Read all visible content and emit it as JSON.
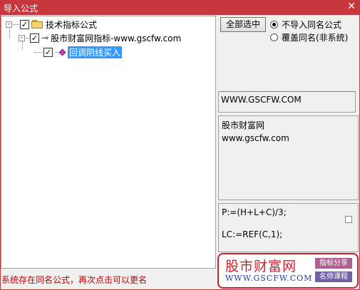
{
  "window": {
    "title": "导入公式",
    "close": "✕"
  },
  "tree": {
    "root": {
      "label": "技术指标公式",
      "expander": "-"
    },
    "child": {
      "label": "股市财富网指标-www.gscfw.com",
      "expander": "-"
    },
    "leaf": {
      "label": "回调阴线买入"
    }
  },
  "controls": {
    "select_all": "全部选中",
    "radio_skip": "不导入同名公式",
    "radio_overwrite": "覆盖同名(非系统)"
  },
  "url_box": "WWW.GSCFW.COM",
  "info": {
    "line1": "股市财富网",
    "line2": "www.gscfw.com"
  },
  "code": {
    "line1": "P:=(H+L+C)/3;",
    "line2": "LC:=REF(C,1);"
  },
  "status": "系统存在同名公式，再次点击可以更名",
  "banner": {
    "brand": "股市财富网",
    "site": "WWW.GSCFW.COM",
    "tag1": "指标分享",
    "tag2": "名师课程"
  },
  "colors": {
    "titlebar": "#c8373e",
    "selection": "#3399ff",
    "status": "#c00000"
  }
}
